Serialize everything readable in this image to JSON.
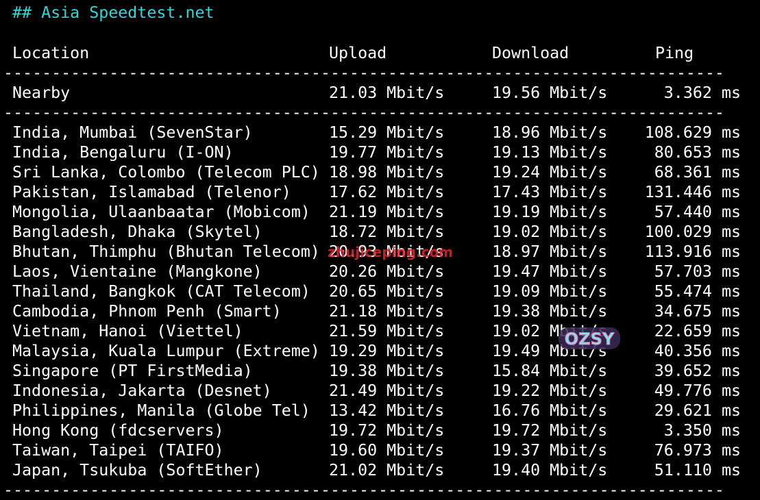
{
  "heading": "## Asia Speedtest.net",
  "headers": {
    "location": "Location",
    "upload": "Upload",
    "download": "Download",
    "ping": "Ping"
  },
  "separator": "------------------------------------------------------------------------------------",
  "nearby": {
    "location": "Nearby",
    "upload": "21.03 Mbit/s",
    "download": "19.56 Mbit/s",
    "ping": "3.362 ms"
  },
  "rows": [
    {
      "location": "India, Mumbai (SevenStar)",
      "upload": "15.29 Mbit/s",
      "download": "18.96 Mbit/s",
      "ping": "108.629 ms"
    },
    {
      "location": "India, Bengaluru (I-ON)",
      "upload": "19.77 Mbit/s",
      "download": "19.13 Mbit/s",
      "ping": "80.653 ms"
    },
    {
      "location": "Sri Lanka, Colombo (Telecom PLC)",
      "upload": "18.98 Mbit/s",
      "download": "19.24 Mbit/s",
      "ping": "68.361 ms"
    },
    {
      "location": "Pakistan, Islamabad (Telenor)",
      "upload": "17.62 Mbit/s",
      "download": "17.43 Mbit/s",
      "ping": "131.446 ms"
    },
    {
      "location": "Mongolia, Ulaanbaatar (Mobicom)",
      "upload": "21.19 Mbit/s",
      "download": "19.19 Mbit/s",
      "ping": "57.440 ms"
    },
    {
      "location": "Bangladesh, Dhaka (Skytel)",
      "upload": "18.72 Mbit/s",
      "download": "19.02 Mbit/s",
      "ping": "100.029 ms"
    },
    {
      "location": "Bhutan, Thimphu (Bhutan Telecom)",
      "upload": "20.93 Mbit/s",
      "download": "18.97 Mbit/s",
      "ping": "113.916 ms"
    },
    {
      "location": "Laos, Vientaine (Mangkone)",
      "upload": "20.26 Mbit/s",
      "download": "19.47 Mbit/s",
      "ping": "57.703 ms"
    },
    {
      "location": "Thailand, Bangkok (CAT Telecom)",
      "upload": "20.65 Mbit/s",
      "download": "19.09 Mbit/s",
      "ping": "55.474 ms"
    },
    {
      "location": "Cambodia, Phnom Penh (Smart)",
      "upload": "21.18 Mbit/s",
      "download": "19.38 Mbit/s",
      "ping": "34.675 ms"
    },
    {
      "location": "Vietnam, Hanoi (Viettel)",
      "upload": "21.59 Mbit/s",
      "download": "19.02 Mbit/s",
      "ping": "22.659 ms"
    },
    {
      "location": "Malaysia, Kuala Lumpur (Extreme)",
      "upload": "19.29 Mbit/s",
      "download": "19.49 Mbit/s",
      "ping": "40.356 ms"
    },
    {
      "location": "Singapore (PT FirstMedia)",
      "upload": "19.38 Mbit/s",
      "download": "15.84 Mbit/s",
      "ping": "39.652 ms"
    },
    {
      "location": "Indonesia, Jakarta (Desnet)",
      "upload": "21.49 Mbit/s",
      "download": "19.22 Mbit/s",
      "ping": "49.776 ms"
    },
    {
      "location": "Philippines, Manila (Globe Tel)",
      "upload": "13.42 Mbit/s",
      "download": "16.76 Mbit/s",
      "ping": "29.621 ms"
    },
    {
      "location": "Hong Kong (fdcservers)",
      "upload": "19.72 Mbit/s",
      "download": "19.72 Mbit/s",
      "ping": "3.350 ms"
    },
    {
      "location": "Taiwan, Taipei (TAIFO)",
      "upload": "19.60 Mbit/s",
      "download": "19.37 Mbit/s",
      "ping": "76.973 ms"
    },
    {
      "location": "Japan, Tsukuba (SoftEther)",
      "upload": "21.02 Mbit/s",
      "download": "19.40 Mbit/s",
      "ping": "51.110 ms"
    }
  ],
  "watermark_text": "zhujiceping.com",
  "watermark_logo": "OZSY",
  "colors": {
    "background": "#000000",
    "text": "#ffffff",
    "heading": "#33d6d6",
    "watermark": "#e0282c"
  }
}
